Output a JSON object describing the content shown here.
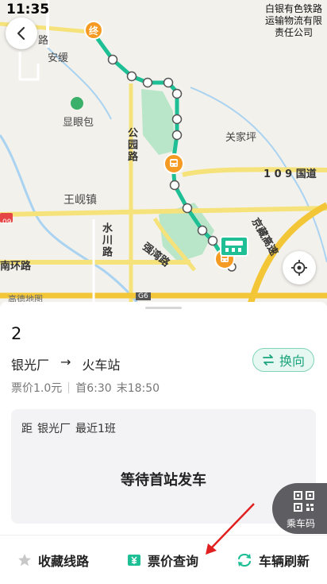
{
  "status_bar": {
    "time": "11:35"
  },
  "map": {
    "corner_text": [
      "白银有色铁路",
      "运输物流有限",
      "责任公司"
    ],
    "labels": {
      "anyuan": "安缓",
      "xianyanbao": "显眼包",
      "guanjiaping": "关家坪",
      "highway_109": "1 0 9 国道",
      "wangxianzhen": "王岘镇",
      "gongyuan_road": "公园路",
      "shuichuan_road": "水川路",
      "qiangwan_road": "强湾路",
      "jingzang": "京藏高速",
      "nanhuan_road": "南环路",
      "top_road": "路",
      "g6": "G6",
      "shield_09": "09"
    },
    "gaode_logo": "高德地图",
    "start_marker": "终",
    "colors": {
      "route": "#1fbf96",
      "stop_marker": "#f59a23",
      "park": "#b9e6c8"
    }
  },
  "sheet": {
    "line_number": "2",
    "route_from": "银光厂",
    "route_arrow": "→",
    "route_to": "火车站",
    "fare": "票价1.0元",
    "first_bus": "首6:30",
    "last_bus": "末18:50",
    "swap_label": "换向",
    "card_prefix": "距",
    "card_station": "银光厂",
    "card_info": "最近1班",
    "card_status": "等待首站发车",
    "qr_label": "乘车码"
  },
  "bottom_bar": {
    "favorite_label": "收藏线路",
    "fare_query_label": "票价查询",
    "refresh_label": "车辆刷新"
  }
}
